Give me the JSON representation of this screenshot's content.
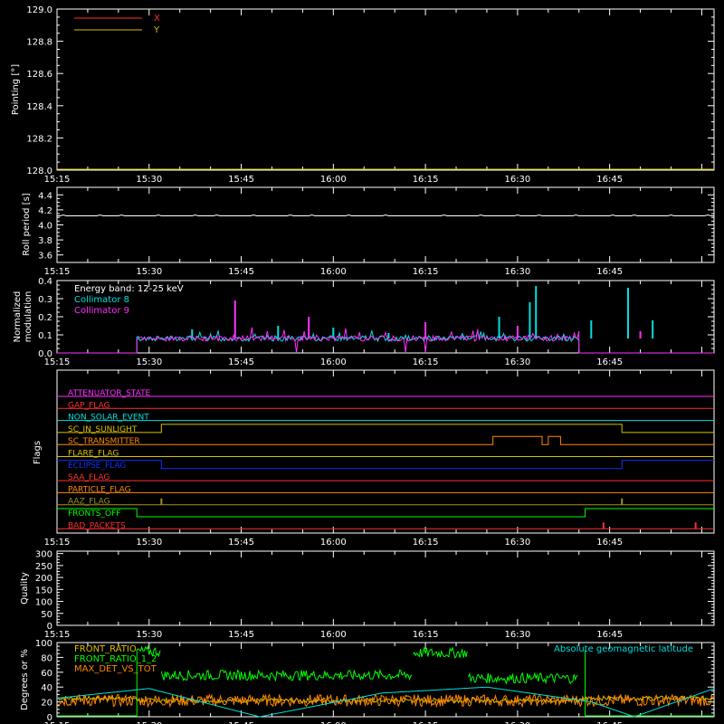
{
  "time_tick_labels": [
    "15:15",
    "15:30",
    "15:45",
    "16:00",
    "16:15",
    "16:30",
    "16:45"
  ],
  "time_axis": {
    "start_minute": 915,
    "end_minute": 1022,
    "label_start_minute": 915,
    "label_step_minutes": 15
  },
  "colors": {
    "red": "#ff3030",
    "yellow": "#d8c000",
    "cyan": "#00e0e0",
    "magenta": "#ff30ff",
    "orange": "#ff8800",
    "blue": "#1030ff",
    "green": "#00ff00",
    "olive": "#a09020",
    "white": "#ffffff"
  },
  "chart_data": [
    {
      "type": "line",
      "ylabel": "Pointing [°]",
      "ylim": [
        128.0,
        129.0
      ],
      "yticks": [
        "128.0",
        "128.2",
        "128.4",
        "128.6",
        "128.8",
        "129.0"
      ],
      "ytick_values": [
        128.0,
        128.2,
        128.4,
        128.6,
        128.8,
        129.0
      ],
      "legend": [
        "X",
        "Y"
      ],
      "series": [
        {
          "name": "X",
          "color": "#ff3030",
          "points": []
        },
        {
          "name": "Y",
          "color": "#d8c000",
          "points": []
        }
      ]
    },
    {
      "type": "line",
      "ylabel": "Roll period [s]",
      "ylim": [
        3.5,
        4.5
      ],
      "yticks": [
        "3.6",
        "3.8",
        "4.0",
        "4.2",
        "4.4"
      ],
      "ytick_values": [
        3.6,
        3.8,
        4.0,
        4.2,
        4.4
      ],
      "series": [
        {
          "name": "roll",
          "color": "#ffffff",
          "value": 4.12,
          "range": [
            915,
            1022
          ]
        }
      ]
    },
    {
      "type": "line",
      "ylabel": "Normalized modulation",
      "ylabel_lines": [
        "Normalized",
        "modulation"
      ],
      "ylim": [
        0,
        0.4
      ],
      "yticks": [
        "0.0",
        "0.1",
        "0.2",
        "0.3",
        "0.4"
      ],
      "ytick_values": [
        0.0,
        0.1,
        0.2,
        0.3,
        0.4
      ],
      "legend": [
        "Energy band: 12-25 keV",
        "Collimator 8",
        "Collimator 9"
      ],
      "series": [
        {
          "name": "Collimator 8",
          "color": "#00e0e0",
          "active": [
            928,
            1000
          ],
          "baseline": 0.08,
          "spikes": [
            [
              937,
              0.13
            ],
            [
              951,
              0.15
            ],
            [
              960,
              0.14
            ],
            [
              969,
              0.11
            ],
            [
              987,
              0.2
            ],
            [
              992,
              0.28
            ],
            [
              993,
              0.37
            ],
            [
              1002,
              0.18
            ],
            [
              1008,
              0.36
            ],
            [
              1012,
              0.18
            ]
          ]
        },
        {
          "name": "Collimator 9",
          "color": "#ff30ff",
          "active": [
            928,
            1000
          ],
          "baseline": 0.08,
          "spikes": [
            [
              944,
              0.29
            ],
            [
              956,
              0.2
            ],
            [
              975,
              0.17
            ],
            [
              990,
              0.15
            ],
            [
              1010,
              0.12
            ]
          ]
        }
      ]
    },
    {
      "type": "line",
      "ylabel": "Flags",
      "flags": [
        {
          "name": "ATTENUATOR_STATE",
          "color": "#ff30ff",
          "segments": [
            [
              915,
              1022,
              0
            ]
          ]
        },
        {
          "name": "GAP_FLAG",
          "color": "#ff3030",
          "segments": [
            [
              915,
              1022,
              0
            ]
          ]
        },
        {
          "name": "NON_SOLAR_EVENT",
          "color": "#00e0e0",
          "segments": [
            [
              915,
              1022,
              0
            ]
          ]
        },
        {
          "name": "SC_IN_SUNLIGHT",
          "color": "#d8c000",
          "segments": [
            [
              915,
              932,
              0
            ],
            [
              932,
              1007,
              1
            ],
            [
              1007,
              1022,
              0
            ]
          ]
        },
        {
          "name": "SC_TRANSMITTER",
          "color": "#ff8800",
          "segments": [
            [
              915,
              986,
              0
            ],
            [
              986,
              994,
              1
            ],
            [
              994,
              995,
              0
            ],
            [
              995,
              997,
              1
            ],
            [
              997,
              1022,
              0
            ]
          ]
        },
        {
          "name": "FLARE_FLAG",
          "color": "#d8c000",
          "segments": [
            [
              915,
              1022,
              0
            ]
          ]
        },
        {
          "name": "ECLIPSE_FLAG",
          "color": "#1030ff",
          "segments": [
            [
              915,
              932,
              1
            ],
            [
              932,
              1007,
              0
            ],
            [
              1007,
              1022,
              1
            ]
          ]
        },
        {
          "name": "SAA_FLAG",
          "color": "#ff3030",
          "segments": [
            [
              915,
              1022,
              0
            ]
          ]
        },
        {
          "name": "PARTICLE_FLAG",
          "color": "#ff8800",
          "segments": [
            [
              915,
              1022,
              0
            ]
          ]
        },
        {
          "name": "AAZ_FLAG",
          "color": "#a09020",
          "segments": [
            [
              915,
              1022,
              0
            ]
          ],
          "pulses": [
            932,
            1007
          ]
        },
        {
          "name": "FRONTS_OFF",
          "color": "#00ff00",
          "segments": [
            [
              915,
              928,
              1
            ],
            [
              928,
              1001,
              0
            ],
            [
              1001,
              1022,
              1
            ]
          ]
        },
        {
          "name": "BAD_PACKETS",
          "color": "#ff3030",
          "segments": [
            [
              915,
              1022,
              0
            ]
          ],
          "pulses": [
            1004,
            1019
          ]
        }
      ]
    },
    {
      "type": "line",
      "ylabel": "Quality",
      "ylim": [
        0,
        310
      ],
      "yticks": [
        "0",
        "50",
        "100",
        "150",
        "200",
        "250",
        "300"
      ],
      "ytick_values": [
        0,
        50,
        100,
        150,
        200,
        250,
        300
      ],
      "series": []
    },
    {
      "type": "line",
      "ylabel": "Degrees or %",
      "ylim": [
        0,
        100
      ],
      "yticks": [
        "0",
        "20",
        "40",
        "60",
        "80",
        "100"
      ],
      "ytick_values": [
        0,
        20,
        40,
        60,
        80,
        100
      ],
      "legend": [
        "FRONT_RATIO",
        "FRONT_RATIO_1_2",
        "MAX_DET_VS_TOT",
        "Absolute geomagnetic latitude"
      ],
      "series": [
        {
          "name": "FRONT_RATIO",
          "color": "#d8c000",
          "segments": [
            [
              915,
              928,
              25
            ],
            [
              928,
              1001,
              22
            ],
            [
              1001,
              1022,
              25
            ]
          ]
        },
        {
          "name": "FRONT_RATIO_1_2",
          "color": "#00ff00",
          "segments": [
            [
              928,
              932,
              88
            ],
            [
              932,
              973,
              56
            ],
            [
              973,
              982,
              86
            ],
            [
              982,
              1000,
              52
            ]
          ]
        },
        {
          "name": "MAX_DET_VS_TOT",
          "color": "#ff8800",
          "segments": [
            [
              915,
              1022,
              22
            ]
          ]
        },
        {
          "name": "Absolute geomagnetic latitude",
          "color": "#00e0e0",
          "points": [
            [
              915,
              25
            ],
            [
              930,
              38
            ],
            [
              948,
              0
            ],
            [
              968,
              32
            ],
            [
              985,
              40
            ],
            [
              1002,
              20
            ],
            [
              1009,
              0
            ],
            [
              1022,
              38
            ]
          ]
        }
      ]
    }
  ]
}
